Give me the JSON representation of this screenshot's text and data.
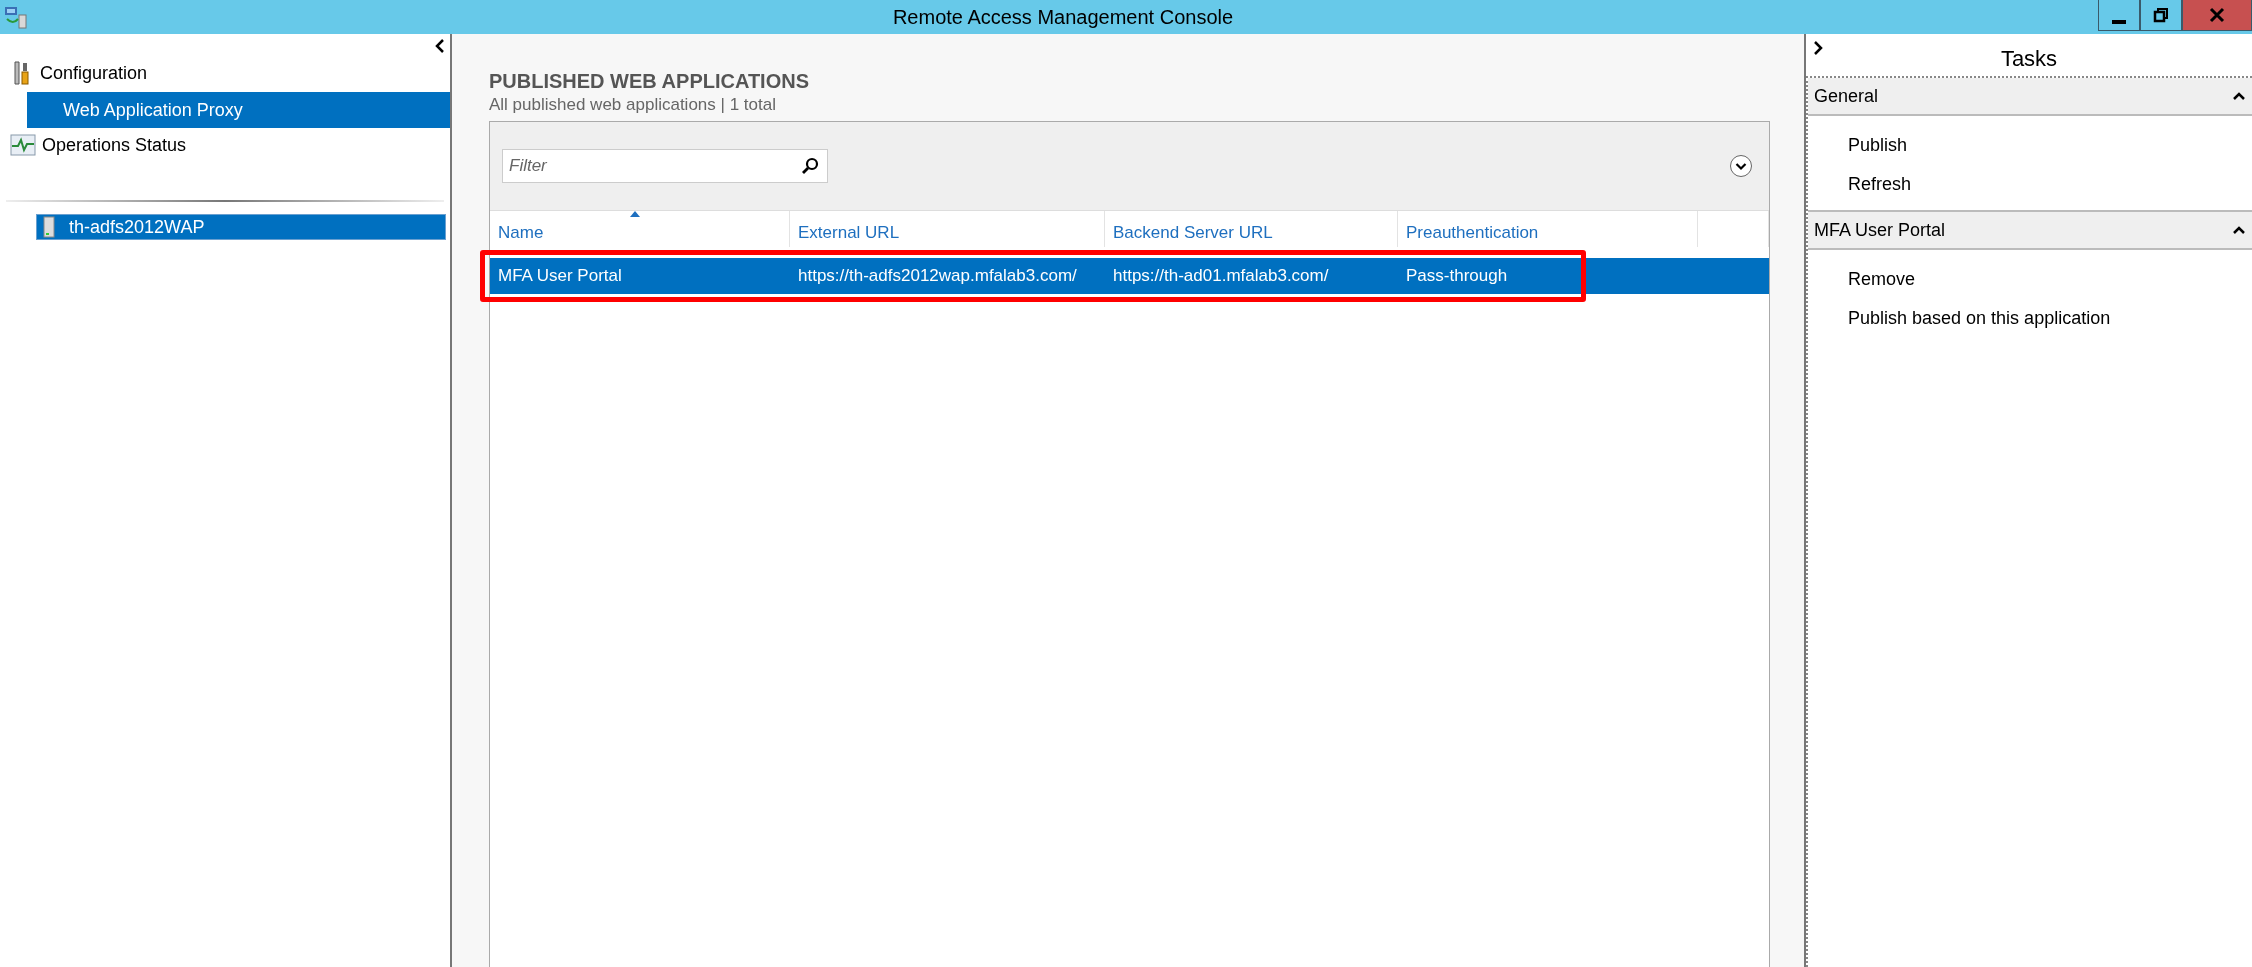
{
  "window": {
    "title": "Remote Access Management Console"
  },
  "nav": {
    "items": [
      {
        "label": "Configuration",
        "kind": "tools",
        "selected": false,
        "children": [
          {
            "label": "Web Application Proxy",
            "selected": true
          }
        ]
      },
      {
        "label": "Operations Status",
        "kind": "monitor",
        "selected": false
      }
    ],
    "servers": [
      {
        "label": "th-adfs2012WAP",
        "selected": true
      }
    ]
  },
  "content": {
    "heading": "PUBLISHED WEB APPLICATIONS",
    "subtitle": "All published web applications | 1 total",
    "filter": {
      "placeholder": "Filter"
    },
    "table": {
      "columns": [
        {
          "label": "Name",
          "sorted": true
        },
        {
          "label": "External URL",
          "sorted": false
        },
        {
          "label": "Backend Server URL",
          "sorted": false
        },
        {
          "label": "Preauthentication",
          "sorted": false
        }
      ],
      "rows": [
        {
          "cells": [
            "MFA User Portal",
            "https://th-adfs2012wap.mfalab3.com/",
            "https://th-ad01.mfalab3.com/",
            "Pass-through"
          ],
          "selected": true,
          "outlined": true
        }
      ]
    }
  },
  "tasks": {
    "title": "Tasks",
    "sections": [
      {
        "title": "General",
        "expanded": true,
        "items": [
          "Publish",
          "Refresh"
        ]
      },
      {
        "title": "MFA User Portal",
        "expanded": true,
        "items": [
          "Remove",
          "Publish based on this application"
        ]
      }
    ]
  }
}
